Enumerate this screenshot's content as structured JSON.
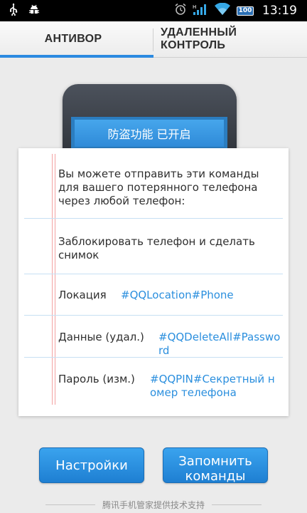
{
  "status_bar": {
    "time": "13:19",
    "battery": "100",
    "icons": [
      "usb-icon",
      "debug-icon",
      "alarm-icon",
      "signal-icon",
      "wifi-icon",
      "battery-icon"
    ]
  },
  "tabs": {
    "antivor": "АНТИВОР",
    "remote": "УДАЛЕННЫЙ\nКОНТРОЛЬ",
    "active_index": 0
  },
  "phone_banner": "防盗功能 已开启",
  "card": {
    "intro": "Вы можете отправить эти команды для вашего потерянного телефона через любой телефон:",
    "lock": "Заблокировать телефон и сделать снимок",
    "location_label": "Локация",
    "location_cmd": "#QQLocation#Phone",
    "data_label": "Данные (удал.)",
    "data_cmd": "#QQDeleteAll#Password",
    "pass_label": "Пароль (изм.)",
    "pass_cmd": "#QQPIN#Секретный номер телефона"
  },
  "buttons": {
    "settings": "Настройки",
    "remember": "Запомнить команды"
  },
  "footer": "腾讯手机管家提供技术支持",
  "colors": {
    "accent": "#2b8ae0",
    "command_text": "#2b8fde",
    "button": "#2a8fe3"
  }
}
